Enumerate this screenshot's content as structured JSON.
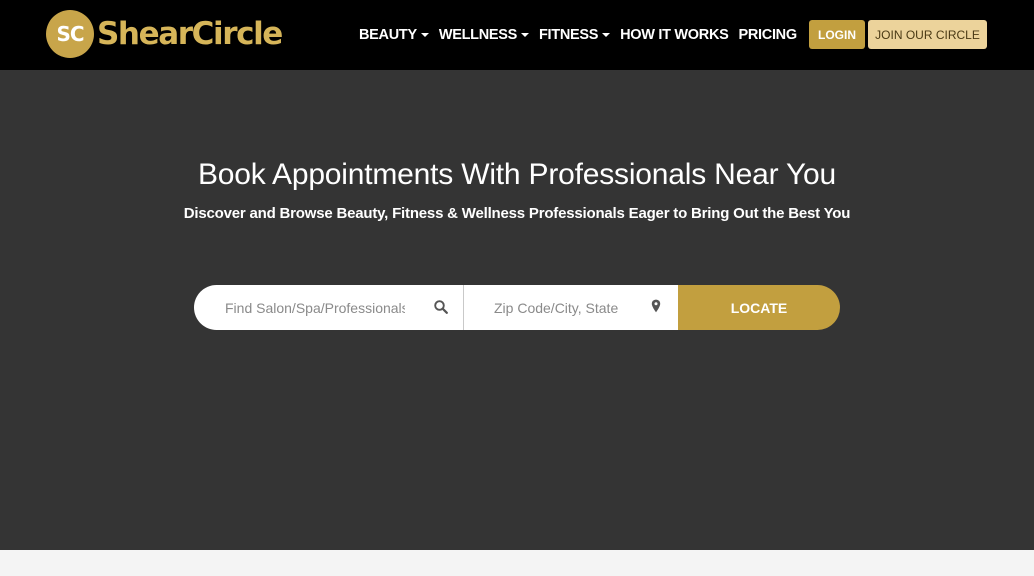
{
  "brand": {
    "badge": "SC",
    "name": "ShearCircle"
  },
  "nav": {
    "items": [
      {
        "label": "BEAUTY",
        "dropdown": true
      },
      {
        "label": "WELLNESS",
        "dropdown": true
      },
      {
        "label": "FITNESS",
        "dropdown": true
      },
      {
        "label": "HOW IT WORKS",
        "dropdown": false
      },
      {
        "label": "PRICING",
        "dropdown": false
      }
    ],
    "login_label": "LOGIN",
    "join_label": "JOIN OUR CIRCLE"
  },
  "hero": {
    "title": "Book Appointments With Professionals Near You",
    "subtitle": "Discover and Browse Beauty, Fitness & Wellness Professionals Eager to Bring Out the Best You"
  },
  "search": {
    "query_placeholder": "Find Salon/Spa/Professionals",
    "query_icon": "search-icon",
    "location_placeholder": "Zip Code/City, State",
    "location_icon": "map-pin-icon",
    "button_label": "LOCATE"
  },
  "colors": {
    "gold": "#c29f3f",
    "gold_light": "#ecd39b",
    "hero_bg": "#343434",
    "nav_bg": "#000000"
  }
}
